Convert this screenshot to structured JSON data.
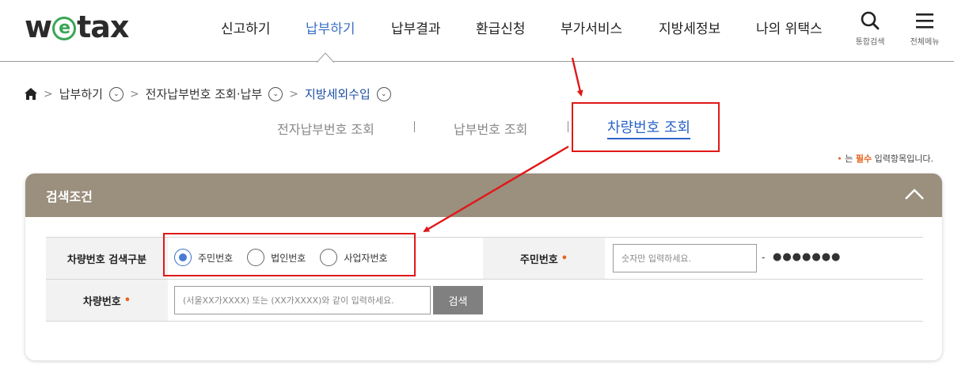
{
  "brand": {
    "logo_w": "w",
    "logo_e": "e",
    "logo_tax": "tax",
    "accent": "#3aa655"
  },
  "nav": {
    "items": [
      "신고하기",
      "납부하기",
      "납부결과",
      "환급신청",
      "부가서비스",
      "지방세정보",
      "나의 위택스"
    ],
    "active_index": 1,
    "search_label": "통합검색",
    "menu_label": "전체메뉴"
  },
  "breadcrumb": {
    "home_icon": "home-icon",
    "items": [
      "납부하기",
      "전자납부번호 조회·납부",
      "지방세외수입"
    ]
  },
  "tabs": {
    "items": [
      "전자납부번호 조회",
      "납부번호 조회",
      "차량번호 조회"
    ],
    "active_index": 2
  },
  "required_note": {
    "bullet": "•",
    "pre": " 는 ",
    "word": "필수",
    "post": " 입력항목입니다."
  },
  "panel": {
    "title": "검색조건",
    "row1": {
      "label": "차량번호 검색구분",
      "radios": [
        "주민번호",
        "법인번호",
        "사업자번호"
      ],
      "selected_index": 0,
      "id_label": "주민번호",
      "id_placeholder": "숫자만 입력하세요.",
      "dash": "-",
      "masked": "●●●●●●●"
    },
    "row2": {
      "label": "차량번호",
      "placeholder": "(서울XX가XXXX) 또는 (XX가XXXX)와 같이 입력하세요.",
      "button": "검색"
    },
    "required_dot": "•"
  },
  "colors": {
    "panel_header": "#9b8f7e",
    "active_blue": "#2a63c8",
    "required_orange": "#e8601c",
    "annotation_red": "#e01818"
  }
}
